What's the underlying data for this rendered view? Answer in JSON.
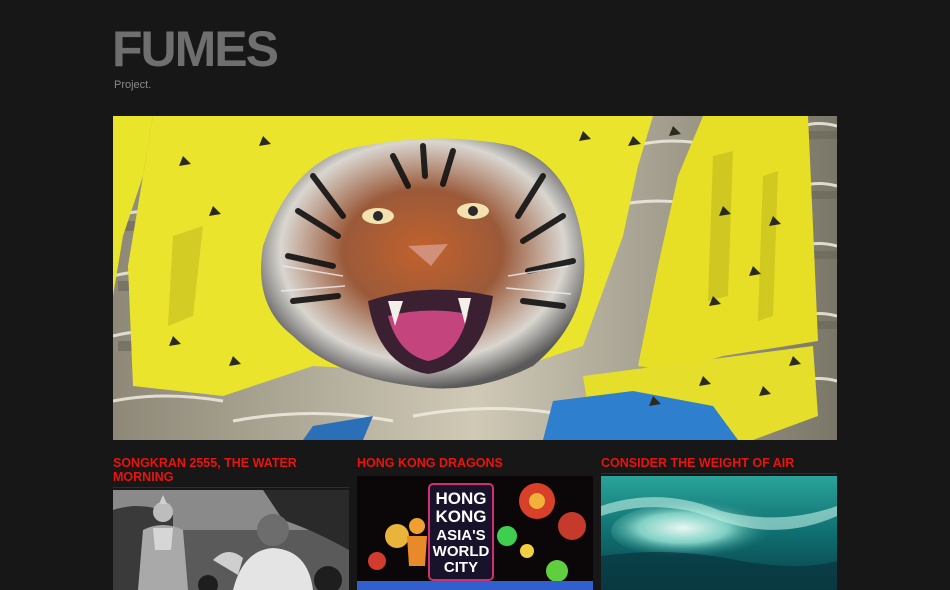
{
  "site": {
    "logo": "FUMES",
    "tagline": "Project."
  },
  "hero": {
    "image_alt": "tiger-banner-on-building"
  },
  "posts": [
    {
      "title": "SONGKRAN 2555, THE WATER MORNING",
      "thumb": "buddha-statue-photo"
    },
    {
      "title": "HONG KONG DRAGONS",
      "thumb": "neon-signs-photo",
      "sign_lines": [
        "HONG",
        "KONG",
        "ASIA'S",
        "WORLD",
        "CITY"
      ]
    },
    {
      "title": "CONSIDER THE WEIGHT OF AIR",
      "thumb": "ocean-wave-photo"
    }
  ],
  "colors": {
    "background": "#171717",
    "logo": "#6f6f6f",
    "post_title": "#e8140f"
  }
}
